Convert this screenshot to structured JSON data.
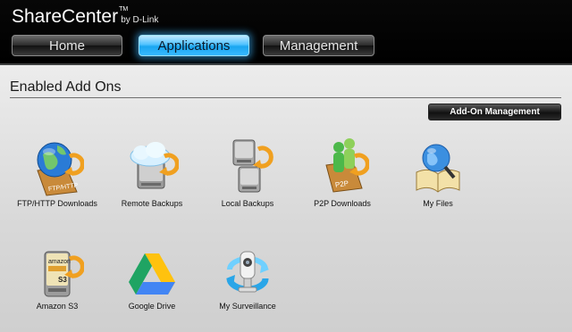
{
  "header": {
    "brand": "ShareCenter",
    "brand_tm": "TM",
    "brand_by": "by D-Link",
    "tabs": [
      {
        "label": "Home",
        "active": false
      },
      {
        "label": "Applications",
        "active": true
      },
      {
        "label": "Management",
        "active": false
      }
    ]
  },
  "main": {
    "section_title": "Enabled Add Ons",
    "addon_management_label": "Add-On Management",
    "addons": [
      {
        "label": "FTP/HTTP Downloads",
        "icon": "ftp-http-globe-icon"
      },
      {
        "label": "Remote Backups",
        "icon": "cloud-backup-icon"
      },
      {
        "label": "Local Backups",
        "icon": "local-backup-drives-icon"
      },
      {
        "label": "P2P Downloads",
        "icon": "p2p-users-icon"
      },
      {
        "label": "My Files",
        "icon": "my-files-globe-book-icon"
      },
      {
        "label": "Amazon S3",
        "icon": "amazon-s3-drive-icon"
      },
      {
        "label": "Google Drive",
        "icon": "google-drive-icon"
      },
      {
        "label": "My Surveillance",
        "icon": "surveillance-camera-icon"
      }
    ],
    "icon_text": {
      "ftp": "FTP/HTTP",
      "p2p": "P2P",
      "amazon": "amazon",
      "s3": "S3"
    }
  },
  "colors": {
    "accent_blue": "#1aa6f0",
    "header_bg": "#000000",
    "content_bg": "#d9d9d9",
    "arrow_orange": "#f0a020"
  }
}
